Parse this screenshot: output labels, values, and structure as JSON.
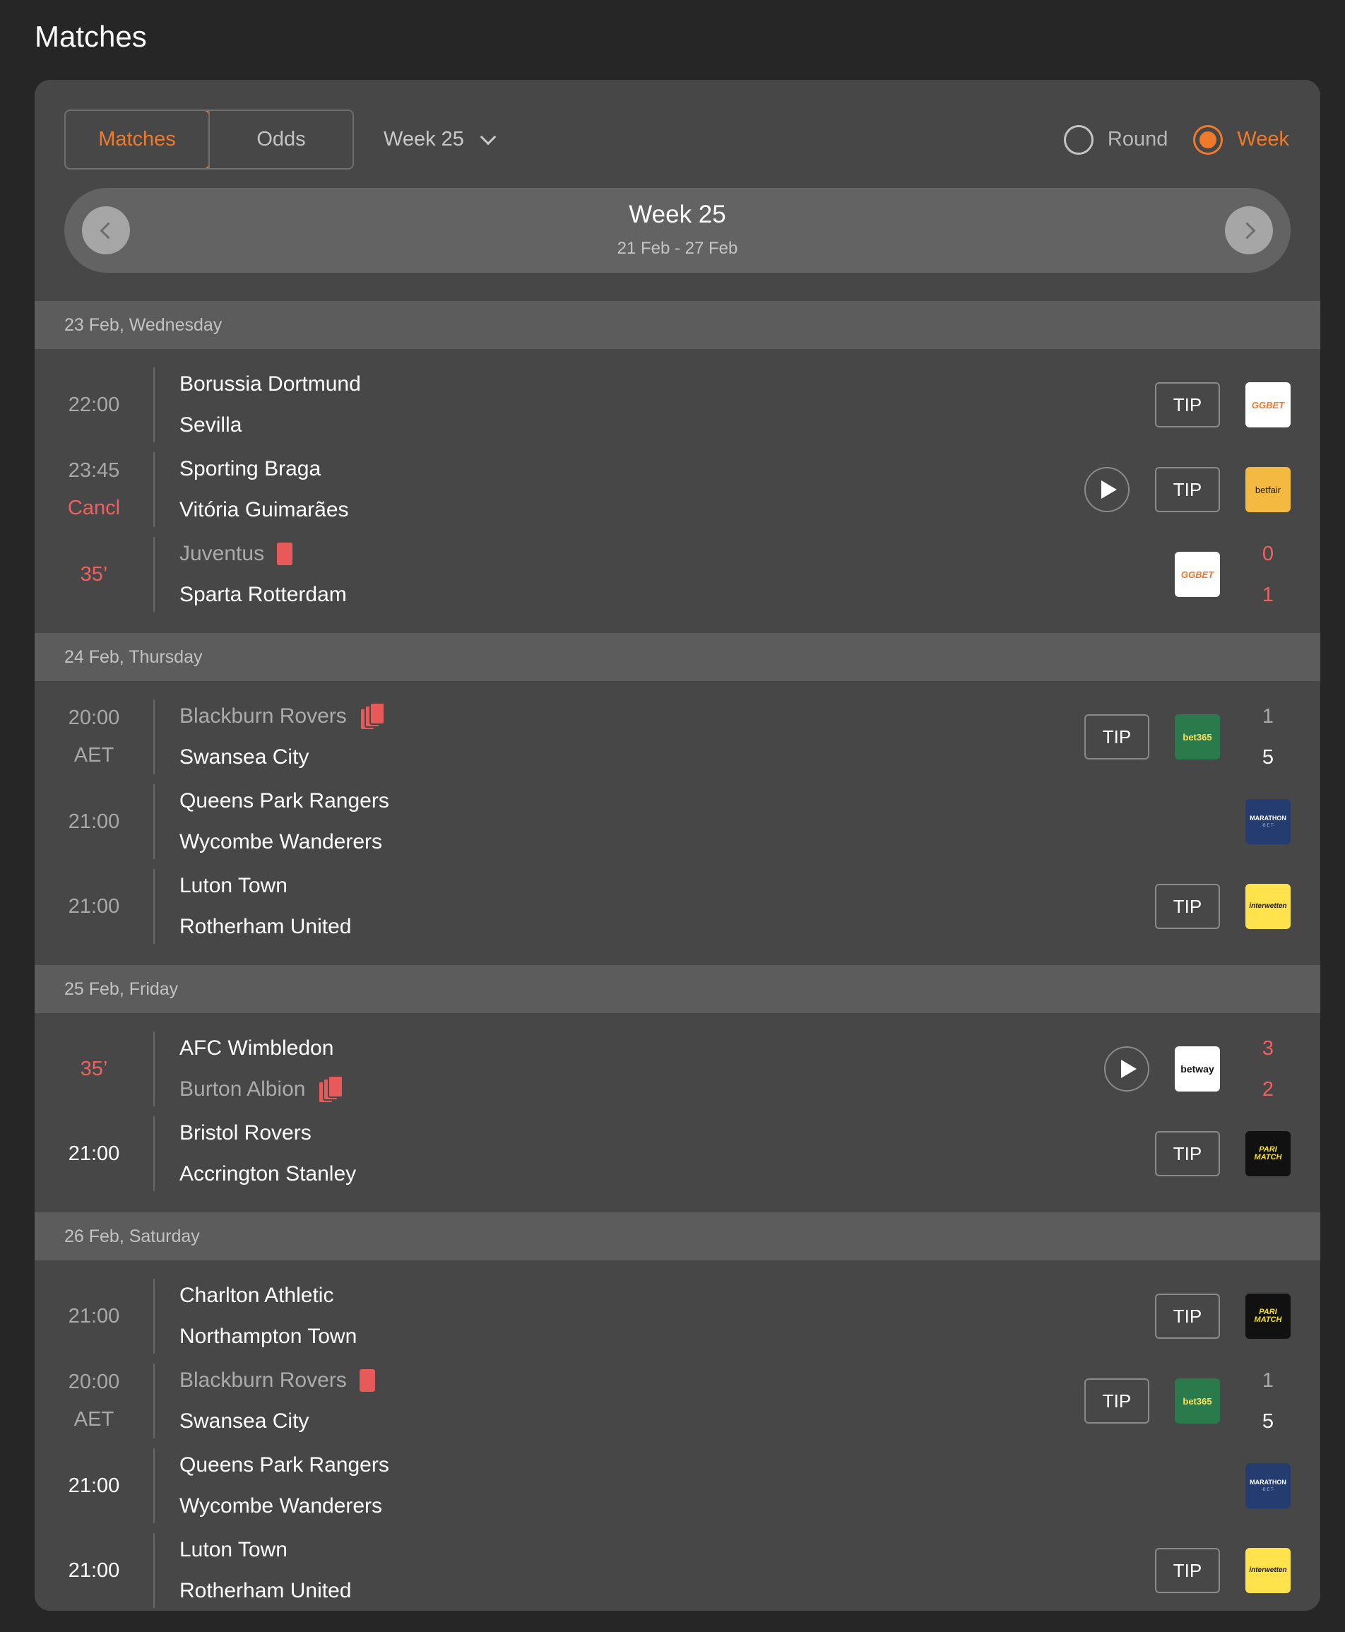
{
  "page_title": "Matches",
  "tabs": [
    {
      "label": "Matches",
      "active": true
    },
    {
      "label": "Odds",
      "active": false
    }
  ],
  "week_select": {
    "value": "Week 25"
  },
  "mode": {
    "round_label": "Round",
    "week_label": "Week",
    "selected": "Week"
  },
  "week_nav": {
    "title": "Week 25",
    "range": "21 Feb - 27 Feb"
  },
  "colors": {
    "accent": "#f07a2b",
    "live": "#ef6060",
    "card": "#474747"
  },
  "days": [
    {
      "label": "23 Feb, Wednesday",
      "matches": [
        {
          "time": "22:00",
          "status": "",
          "home": "Borussia Dortmund",
          "away": "Sevilla",
          "home_card": "",
          "away_card": "",
          "play": false,
          "tip": "TIP",
          "bookmaker": "GGBET",
          "logo_icon": "ggbet-logo-icon",
          "score_home": "",
          "score_away": ""
        },
        {
          "time": "23:45",
          "status": "Cancl",
          "home": "Sporting Braga",
          "away": "Vitória Guimarães",
          "home_card": "",
          "away_card": "",
          "play": true,
          "tip": "TIP",
          "bookmaker": "betfair",
          "logo_icon": "betfair-logo-icon",
          "score_home": "",
          "score_away": ""
        },
        {
          "time": "35’",
          "status": "",
          "live": true,
          "home": "Juventus",
          "away": "Sparta Rotterdam",
          "home_card": "red",
          "away_card": "",
          "home_muted": true,
          "play": false,
          "tip": "",
          "bookmaker": "GGBET",
          "logo_icon": "ggbet-logo-icon",
          "score_home": "0",
          "score_away": "1"
        }
      ]
    },
    {
      "label": "24 Feb, Thursday",
      "matches": [
        {
          "time": "20:00",
          "status": "AET",
          "home": "Blackburn Rovers",
          "away": "Swansea City",
          "home_card": "multi",
          "away_card": "",
          "home_muted": true,
          "play": false,
          "tip": "TIP",
          "bookmaker": "bet365",
          "logo_icon": "bet365-logo-icon",
          "score_home": "1",
          "score_away": "5",
          "finished": true
        },
        {
          "time": "21:00",
          "status": "",
          "home": "Queens Park Rangers",
          "away": "Wycombe Wanderers",
          "home_card": "",
          "away_card": "",
          "play": false,
          "tip": "",
          "bookmaker": "MARATHON",
          "bookmaker_sub": "-B E T-",
          "logo_icon": "marathonbet-logo-icon",
          "score_home": "",
          "score_away": ""
        },
        {
          "time": "21:00",
          "status": "",
          "home": "Luton Town",
          "away": "Rotherham United",
          "home_card": "",
          "away_card": "",
          "play": false,
          "tip": "TIP",
          "bookmaker": "interwetten",
          "logo_icon": "interwetten-logo-icon",
          "score_home": "",
          "score_away": ""
        }
      ]
    },
    {
      "label": "25 Feb, Friday",
      "matches": [
        {
          "time": "35’",
          "status": "",
          "live": true,
          "home": "AFC Wimbledon",
          "away": "Burton Albion",
          "home_card": "",
          "away_card": "multi",
          "away_muted": true,
          "play": true,
          "tip": "",
          "bookmaker": "betway",
          "logo_icon": "betway-logo-icon",
          "score_home": "3",
          "score_away": "2"
        },
        {
          "time": "21:00",
          "status": "",
          "white": true,
          "home": "Bristol Rovers",
          "away": "Accrington Stanley",
          "home_card": "",
          "away_card": "",
          "play": false,
          "tip": "TIP",
          "bookmaker": "PARI MATCH",
          "logo_icon": "parimatch-logo-icon",
          "score_home": "",
          "score_away": ""
        }
      ]
    },
    {
      "label": "26 Feb, Saturday",
      "matches": [
        {
          "time": "21:00",
          "status": "",
          "home": "Charlton Athletic",
          "away": "Northampton Town",
          "home_card": "",
          "away_card": "",
          "play": false,
          "tip": "TIP",
          "bookmaker": "PARI MATCH",
          "logo_icon": "parimatch-logo-icon",
          "score_home": "",
          "score_away": ""
        },
        {
          "time": "20:00",
          "status": "AET",
          "home": "Blackburn Rovers",
          "away": "Swansea City",
          "home_card": "red",
          "away_card": "",
          "home_muted": true,
          "play": false,
          "tip": "TIP",
          "bookmaker": "bet365",
          "logo_icon": "bet365-logo-icon",
          "score_home": "1",
          "score_away": "5",
          "finished": true
        },
        {
          "time": "21:00",
          "status": "",
          "white": true,
          "home": "Queens Park Rangers",
          "away": "Wycombe Wanderers",
          "home_card": "",
          "away_card": "",
          "play": false,
          "tip": "",
          "bookmaker": "MARATHON",
          "bookmaker_sub": "-B E T-",
          "logo_icon": "marathonbet-logo-icon",
          "score_home": "",
          "score_away": ""
        },
        {
          "time": "21:00",
          "status": "",
          "white": true,
          "home": "Luton Town",
          "away": "Rotherham United",
          "home_card": "",
          "away_card": "",
          "play": false,
          "tip": "TIP",
          "bookmaker": "interwetten",
          "logo_icon": "interwetten-logo-icon",
          "score_home": "",
          "score_away": ""
        }
      ]
    }
  ]
}
